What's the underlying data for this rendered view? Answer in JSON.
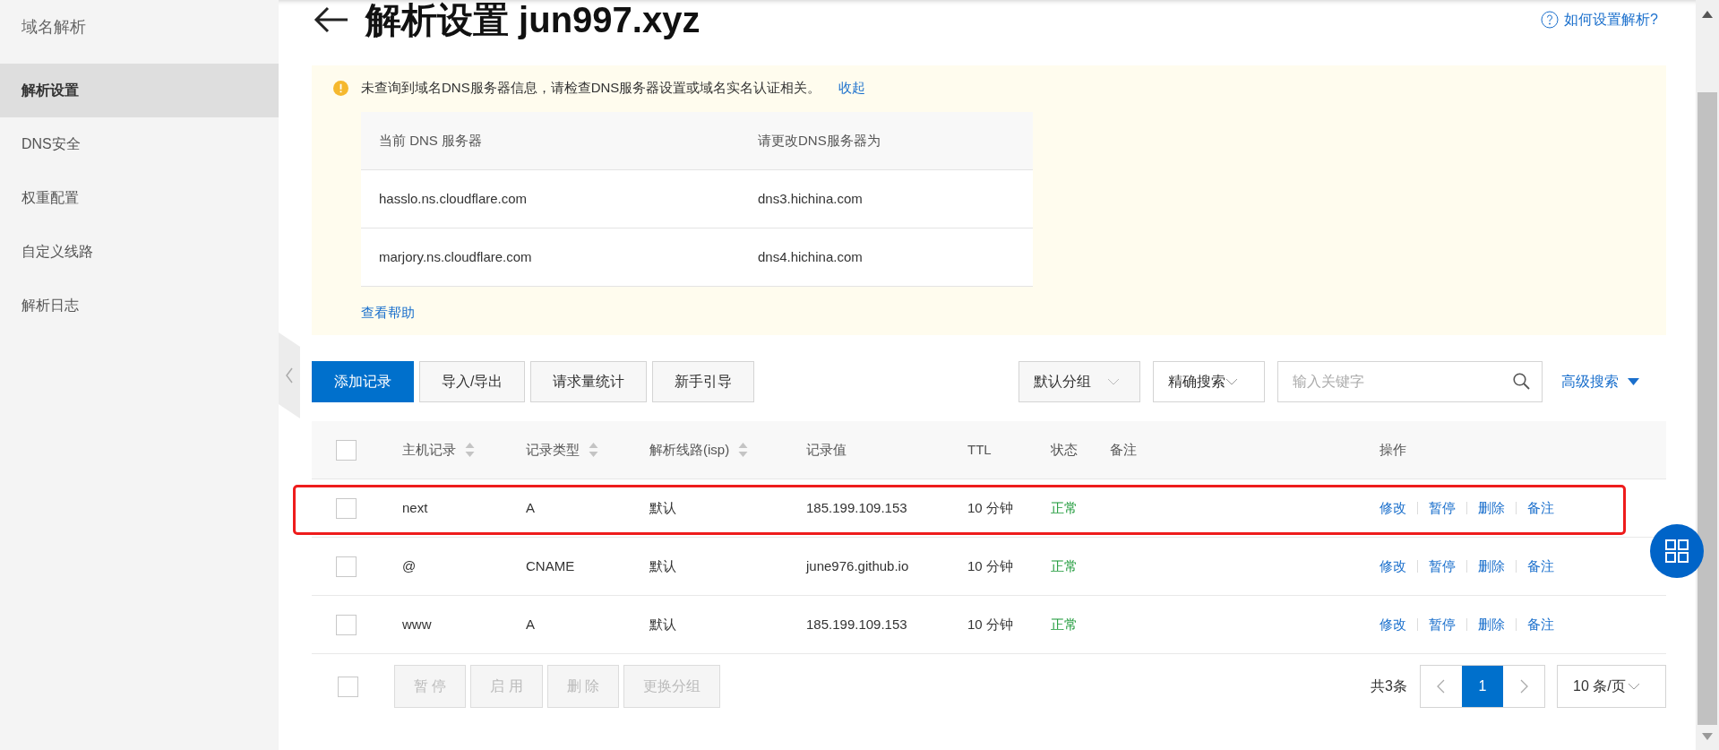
{
  "sidebar": {
    "title": "域名解析",
    "items": [
      {
        "label": "解析设置",
        "selected": true
      },
      {
        "label": "DNS安全",
        "selected": false
      },
      {
        "label": "权重配置",
        "selected": false
      },
      {
        "label": "自定义线路",
        "selected": false
      },
      {
        "label": "解析日志",
        "selected": false
      }
    ]
  },
  "header": {
    "title": "解析设置 jun997.xyz",
    "help_link": "如何设置解析?"
  },
  "notice": {
    "message": "未查询到域名DNS服务器信息，请检查DNS服务器设置或域名实名认证相关。",
    "collapse_link": "收起",
    "table": {
      "columns": [
        "当前 DNS 服务器",
        "请更改DNS服务器为"
      ],
      "rows": [
        [
          "hasslo.ns.cloudflare.com",
          "dns3.hichina.com"
        ],
        [
          "marjory.ns.cloudflare.com",
          "dns4.hichina.com"
        ]
      ]
    },
    "help_link": "查看帮助"
  },
  "toolbar": {
    "buttons": [
      {
        "label": "添加记录",
        "primary": true
      },
      {
        "label": "导入/导出",
        "primary": false
      },
      {
        "label": "请求量统计",
        "primary": false
      },
      {
        "label": "新手引导",
        "primary": false
      }
    ],
    "group_select": "默认分组",
    "search_mode": "精确搜索",
    "search": {
      "placeholder": "输入关键字"
    },
    "advanced_search": "高级搜索"
  },
  "records": {
    "select_all_checked": false,
    "columns": [
      {
        "label": "主机记录",
        "sortable": true
      },
      {
        "label": "记录类型",
        "sortable": true
      },
      {
        "label": "解析线路(isp)",
        "sortable": true
      },
      {
        "label": "记录值",
        "sortable": false
      },
      {
        "label": "TTL",
        "sortable": false
      },
      {
        "label": "状态",
        "sortable": false
      },
      {
        "label": "备注",
        "sortable": false
      },
      {
        "label": "操作",
        "sortable": false
      }
    ],
    "rows": [
      {
        "checked": false,
        "highlighted": true,
        "host": "next",
        "type": "A",
        "line": "默认",
        "value": "185.199.109.153",
        "ttl": "10 分钟",
        "status": "正常",
        "actions": [
          "修改",
          "暂停",
          "删除",
          "备注"
        ]
      },
      {
        "checked": false,
        "highlighted": false,
        "host": "@",
        "type": "CNAME",
        "line": "默认",
        "value": "june976.github.io",
        "ttl": "10 分钟",
        "status": "正常",
        "actions": [
          "修改",
          "暂停",
          "删除",
          "备注"
        ]
      },
      {
        "checked": false,
        "highlighted": false,
        "host": "www",
        "type": "A",
        "line": "默认",
        "value": "185.199.109.153",
        "ttl": "10 分钟",
        "status": "正常",
        "actions": [
          "修改",
          "暂停",
          "删除",
          "备注"
        ]
      }
    ]
  },
  "bulk": {
    "select_all_checked": false,
    "buttons": [
      {
        "label": "暂 停",
        "disabled": true
      },
      {
        "label": "启 用",
        "disabled": true
      },
      {
        "label": "删 除",
        "disabled": true
      },
      {
        "label": "更换分组",
        "disabled": true
      }
    ]
  },
  "pagination": {
    "total": "共3条",
    "pages": [
      {
        "label": "1",
        "selected": true
      }
    ],
    "page_size": "10 条/页"
  }
}
